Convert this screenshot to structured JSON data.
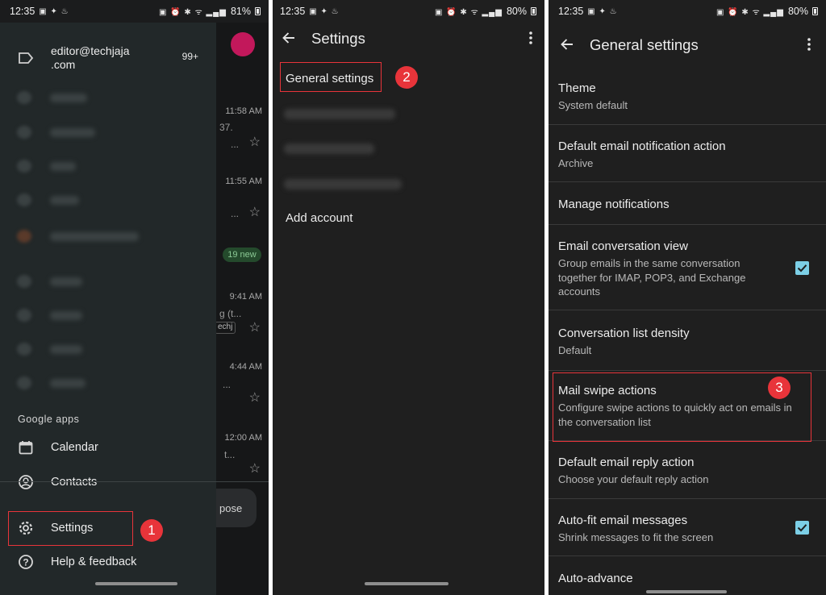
{
  "status_bar": [
    {
      "time": "12:35",
      "battery": "81%"
    },
    {
      "time": "12:35",
      "battery": "80%"
    },
    {
      "time": "12:35",
      "battery": "80%"
    }
  ],
  "drawer": {
    "account_email_line1": "editor@techjaja",
    "account_email_line2": ".com",
    "unread_count": "99+",
    "section_label": "Google apps",
    "items": [
      {
        "label": "Calendar",
        "icon": "calendar-icon"
      },
      {
        "label": "Contacts",
        "icon": "contacts-icon"
      },
      {
        "label": "Settings",
        "icon": "gear-icon"
      },
      {
        "label": "Help & feedback",
        "icon": "help-icon"
      }
    ]
  },
  "inbox_peek": {
    "times": [
      "11:58 AM",
      "11:55 AM",
      "9:41 AM",
      "4:44 AM",
      "12:00 AM"
    ],
    "fragments": [
      "37.",
      "...",
      "...",
      "g (t...",
      "...",
      "t..."
    ],
    "new_badge": "19 new",
    "chip": "echj",
    "compose": "pose"
  },
  "settings_screen": {
    "title": "Settings",
    "general_settings": "General settings",
    "add_account": "Add account"
  },
  "general_settings_screen": {
    "title": "General settings",
    "items": [
      {
        "title": "Theme",
        "subtitle": "System default",
        "checked": false
      },
      {
        "title": "Default email notification action",
        "subtitle": "Archive",
        "checked": false
      },
      {
        "title": "Manage notifications",
        "subtitle": "",
        "checked": false
      },
      {
        "title": "Email conversation view",
        "subtitle": "Group emails in the same conversation together for IMAP, POP3, and Exchange accounts",
        "checked": true
      },
      {
        "title": "Conversation list density",
        "subtitle": "Default",
        "checked": false
      },
      {
        "title": "Mail swipe actions",
        "subtitle": "Configure swipe actions to quickly act on emails in the conversation list",
        "checked": false
      },
      {
        "title": "Default email reply action",
        "subtitle": "Choose your default reply action",
        "checked": false
      },
      {
        "title": "Auto-fit email messages",
        "subtitle": "Shrink messages to fit the screen",
        "checked": true
      },
      {
        "title": "Auto-advance",
        "subtitle": "",
        "checked": false
      }
    ]
  },
  "step_badges": [
    "1",
    "2",
    "3"
  ],
  "colors": {
    "highlight": "#e8343a",
    "checkbox": "#7ccfe6",
    "drawer_bg": "#222829",
    "screen_bg": "#1f1f1f"
  }
}
